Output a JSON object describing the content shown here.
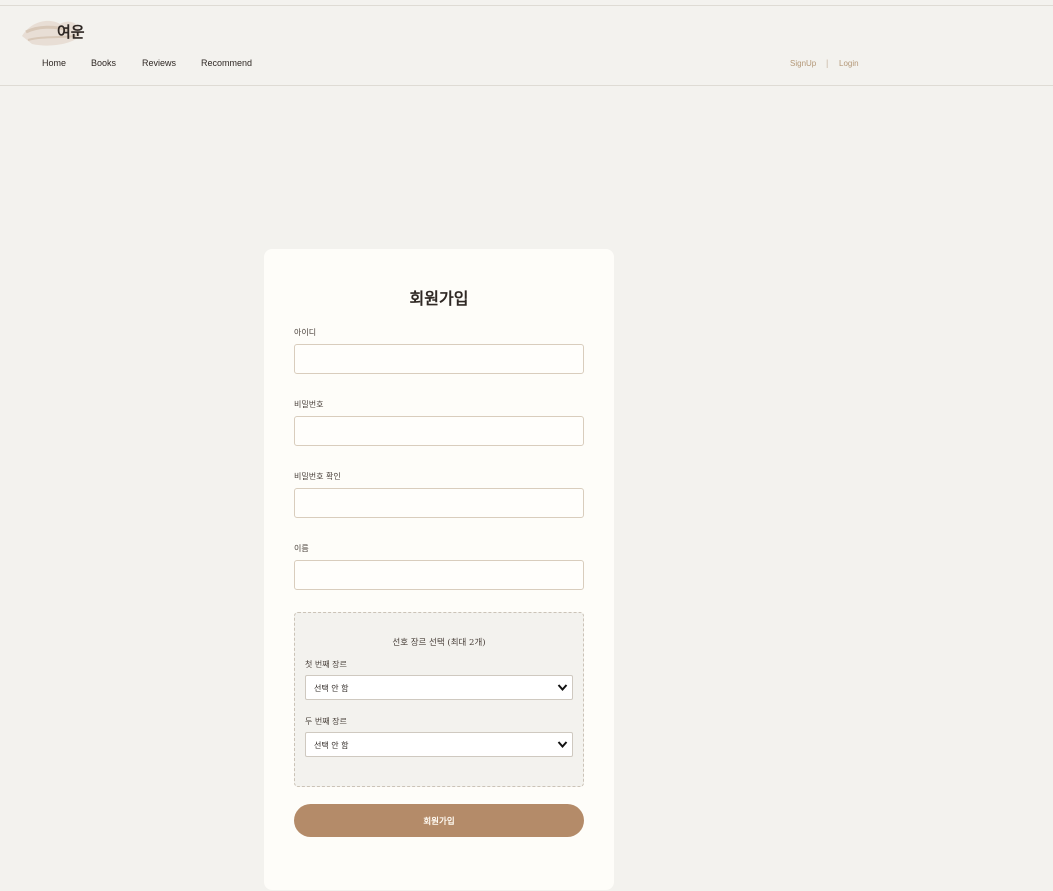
{
  "header": {
    "logo_text": "여운",
    "nav": [
      "Home",
      "Books",
      "Reviews",
      "Recommend"
    ],
    "signup_label": "SignUp",
    "separator": "|",
    "login_label": "Login"
  },
  "form": {
    "title": "회원가입",
    "fields": [
      {
        "label": "아이디",
        "value": ""
      },
      {
        "label": "비밀번호",
        "value": ""
      },
      {
        "label": "비밀번호 확인",
        "value": ""
      },
      {
        "label": "이름",
        "value": ""
      }
    ],
    "genre": {
      "title": "선호 장르 선택 (최대 2개)",
      "first_label": "첫 번째 장르",
      "first_selected": "선택 안 함",
      "second_label": "두 번째 장르",
      "second_selected": "선택 안 함"
    },
    "submit_label": "회원가입"
  },
  "colors": {
    "background": "#f3f2ee",
    "card": "#fefdf9",
    "accent": "#b48b69",
    "auth_link": "#b49878"
  }
}
